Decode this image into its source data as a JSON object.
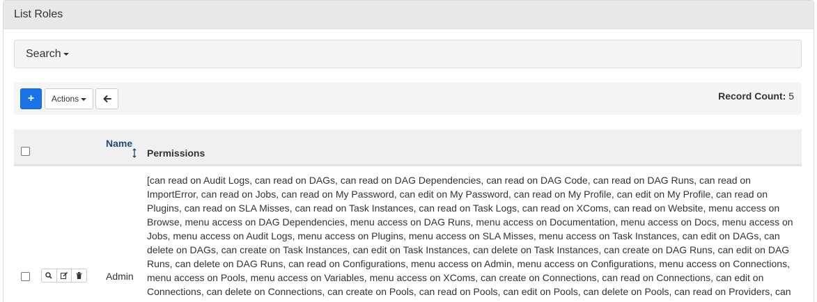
{
  "panel": {
    "title": "List Roles"
  },
  "search": {
    "label": "Search"
  },
  "toolbar": {
    "add_label": "+",
    "actions_label": "Actions",
    "back_label": "🡐",
    "record_count_label": "Record Count:",
    "record_count_value": "5"
  },
  "table": {
    "headers": {
      "name": "Name",
      "permissions": "Permissions"
    },
    "rows": [
      {
        "name": "Admin",
        "permissions": "[can read on Audit Logs, can read on DAGs, can read on DAG Dependencies, can read on DAG Code, can read on DAG Runs, can read on ImportError, can read on Jobs, can read on My Password, can edit on My Password, can read on My Profile, can edit on My Profile, can read on Plugins, can read on SLA Misses, can read on Task Instances, can read on Task Logs, can read on XComs, can read on Website, menu access on Browse, menu access on DAG Dependencies, menu access on DAG Runs, menu access on Documentation, menu access on Docs, menu access on Jobs, menu access on Audit Logs, menu access on Plugins, menu access on SLA Misses, menu access on Task Instances, can edit on DAGs, can delete on DAGs, can create on Task Instances, can edit on Task Instances, can delete on Task Instances, can create on DAG Runs, can edit on DAG Runs, can delete on DAG Runs, can read on Configurations, menu access on Admin, menu access on Configurations, menu access on Connections, menu access on Pools, menu access on Variables, menu access on XComs, can create on Connections, can read on Connections, can edit on Connections, can delete on Connections, can create on Pools, can read on Pools, can edit on Pools, can delete on Pools, can read on Providers, can create on Variables, can read on Variables, can edit on Variables, can delete on Variables, can delete on XComs, can read on Task Reschedules"
      }
    ]
  },
  "icons": {
    "add": "plus-icon",
    "back": "arrow-left-icon",
    "sort": "sort-icon",
    "show": "search-icon",
    "edit": "edit-icon",
    "delete": "trash-icon"
  },
  "colors": {
    "primary": "#1a73e8",
    "header_link": "#1f4b76",
    "panel_heading_bg": "#e8e8e8"
  }
}
